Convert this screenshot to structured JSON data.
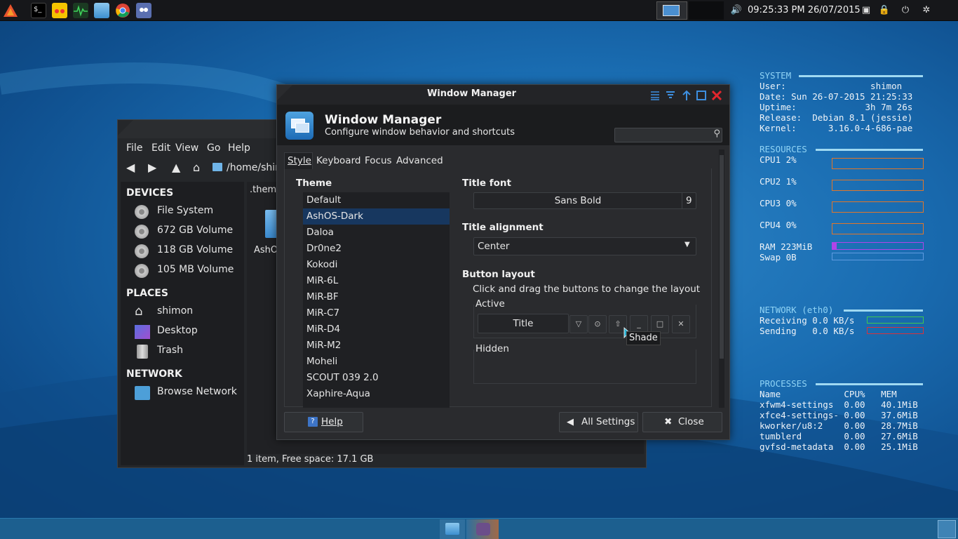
{
  "top_panel": {
    "clock": "09:25:33 PM 26/07/2015"
  },
  "file_manager": {
    "menu": [
      "File",
      "Edit",
      "View",
      "Go",
      "Help"
    ],
    "path": "/home/shin",
    "location_tab": ".them",
    "devices_header": "DEVICES",
    "devices": [
      "File System",
      "672 GB Volume",
      "118 GB Volume",
      "105 MB Volume"
    ],
    "places_header": "PLACES",
    "places": [
      "shimon",
      "Desktop",
      "Trash"
    ],
    "network_header": "NETWORK",
    "network": [
      "Browse Network"
    ],
    "file_label": "AshO",
    "status": "1 item, Free space: 17.1 GB"
  },
  "window_manager": {
    "window_title": "Window Manager",
    "header_title": "Window Manager",
    "header_subtitle": "Configure window behavior and shortcuts",
    "tabs": [
      "Style",
      "Keyboard",
      "Focus",
      "Advanced"
    ],
    "theme_label": "Theme",
    "themes": [
      "Default",
      "AshOS-Dark",
      "Daloa",
      "Dr0ne2",
      "Kokodi",
      "MiR-6L",
      "MiR-BF",
      "MiR-C7",
      "MiR-D4",
      "MiR-M2",
      "Moheli",
      "SCOUT 039 2.0",
      "Xaphire-Aqua"
    ],
    "selected_theme": "AshOS-Dark",
    "title_font_label": "Title font",
    "title_font": "Sans Bold",
    "title_font_size": "9",
    "title_alignment_label": "Title alignment",
    "title_alignment": "Center",
    "button_layout_label": "Button layout",
    "button_layout_hint": "Click and drag the buttons to change the layout",
    "active_label": "Active",
    "title_button": "Title",
    "hidden_label": "Hidden",
    "help_button": "Help",
    "all_settings_button": "All Settings",
    "close_button": "Close",
    "tooltip": "Shade"
  },
  "conky": {
    "system_header": "SYSTEM",
    "system_lines": [
      "User:                shimon",
      "Date: Sun 26-07-2015 21:25:33",
      "Uptime:             3h 7m 26s",
      "Release:  Debian 8.1 (jessie)",
      "Kernel:      3.16.0-4-686-pae"
    ],
    "resources_header": "RESOURCES",
    "cpus": [
      "CPU1 2%",
      "CPU2 1%",
      "CPU3 0%",
      "CPU4 0%"
    ],
    "ram": "RAM 223MiB",
    "ram_usage_fraction": 0.05,
    "swap": "Swap 0B",
    "network_header": "NETWORK (eth0)",
    "net_lines": [
      "Receiving 0.0 KB/s",
      "Sending   0.0 KB/s"
    ],
    "processes_header": "PROCESSES",
    "proc_header": "Name            CPU%   MEM",
    "processes": [
      "xfwm4-settings  0.00   40.1MiB",
      "xfce4-settings- 0.00   37.6MiB",
      "kworker/u8:2    0.00   28.7MiB",
      "tumblerd        0.00   27.6MiB",
      "gvfsd-metadata  0.00   25.1MiB"
    ],
    "colors": {
      "header": "#8fd3f5",
      "cpu_box": "#e0762a",
      "ram_box": "#b044e8",
      "swap_box": "#5f9be0",
      "recv_box": "#3ec94f",
      "send_box": "#d8323c"
    }
  }
}
